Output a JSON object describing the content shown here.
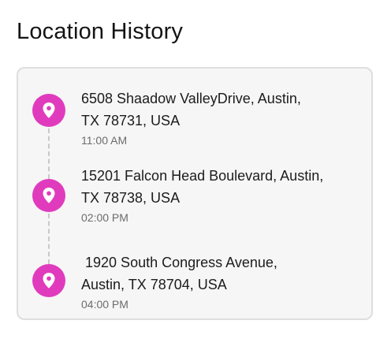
{
  "page": {
    "title": "Location History"
  },
  "colors": {
    "pin": "#e03bbd",
    "card_bg": "#f6f6f6",
    "card_border": "#dedede",
    "time_text": "#6c6c6c"
  },
  "icons": {
    "entry": "map-pin-icon"
  },
  "history": [
    {
      "address": "6508 Shaadow ValleyDrive, Austin,\nTX 78731, USA",
      "time": "11:00 AM"
    },
    {
      "address": "15201 Falcon Head Boulevard, Austin,\nTX 78738, USA",
      "time": "02:00 PM"
    },
    {
      "address": " 1920 South Congress Avenue,\nAustin, TX 78704, USA",
      "time": "04:00 PM"
    }
  ]
}
